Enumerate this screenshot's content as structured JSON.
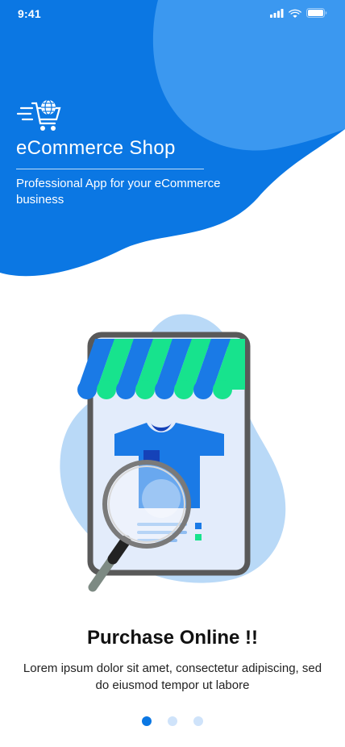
{
  "status_bar": {
    "time": "9:41",
    "icons": [
      "signal-icon",
      "wifi-icon",
      "battery-icon"
    ]
  },
  "brand": {
    "logo_icon": "fast-cart-globe-icon",
    "title": "eCommerce Shop",
    "tagline": "Professional App for your eCommerce business"
  },
  "illustration": {
    "icon": "shop-search-illustration"
  },
  "slide": {
    "title": "Purchase Online !!",
    "description": "Lorem ipsum dolor sit amet, consectetur adipiscing, sed do eiusmod tempor ut labore"
  },
  "pager": {
    "count": 3,
    "active_index": 0
  },
  "colors": {
    "primary": "#0b77e3",
    "primary_light": "#3b98f0",
    "blob": "#b9d9f7",
    "awning_green": "#17e38d",
    "awning_blue": "#1a7ae6",
    "device_frame": "#595959"
  }
}
